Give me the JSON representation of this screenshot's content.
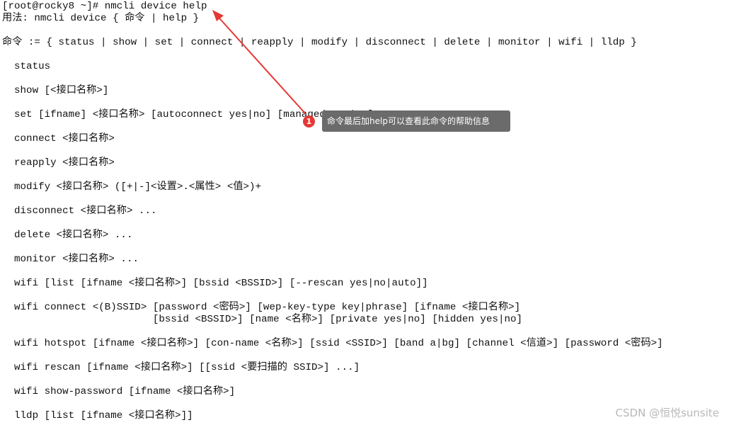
{
  "terminal": {
    "lines": [
      "[root@rocky8 ~]# nmcli device help",
      "用法: nmcli device { 命令 | help }",
      "命令 := { status | show | set | connect | reapply | modify | disconnect | delete | monitor | wifi | lldp }",
      "  status",
      "  show [<接口名称>]",
      "  set [ifname] <接口名称> [autoconnect yes|no] [managed yes|no]",
      "  connect <接口名称>",
      "  reapply <接口名称>",
      "  modify <接口名称> ([+|-]<设置>.<属性> <值>)+",
      "  disconnect <接口名称> ...",
      "  delete <接口名称> ...",
      "  monitor <接口名称> ...",
      "  wifi [list [ifname <接口名称>] [bssid <BSSID>] [--rescan yes|no|auto]]",
      "  wifi connect <(B)SSID> [password <密码>] [wep-key-type key|phrase] [ifname <接口名称>]",
      "                         [bssid <BSSID>] [name <名称>] [private yes|no] [hidden yes|no]",
      "  wifi hotspot [ifname <接口名称>] [con-name <名称>] [ssid <SSID>] [band a|bg] [channel <信道>] [password <密码>]",
      "  wifi rescan [ifname <接口名称>] [[ssid <要扫描的 SSID>] ...]",
      "  wifi show-password [ifname <接口名称>]",
      "  lldp [list [ifname <接口名称>]]"
    ]
  },
  "annotation": {
    "badge": "1",
    "tooltip": "命令最后加help可以查看此命令的帮助信息",
    "arrow_color": "#e53935",
    "tooltip_bg": "#6b6b6b"
  },
  "watermark": "CSDN @恒悦sunsite"
}
